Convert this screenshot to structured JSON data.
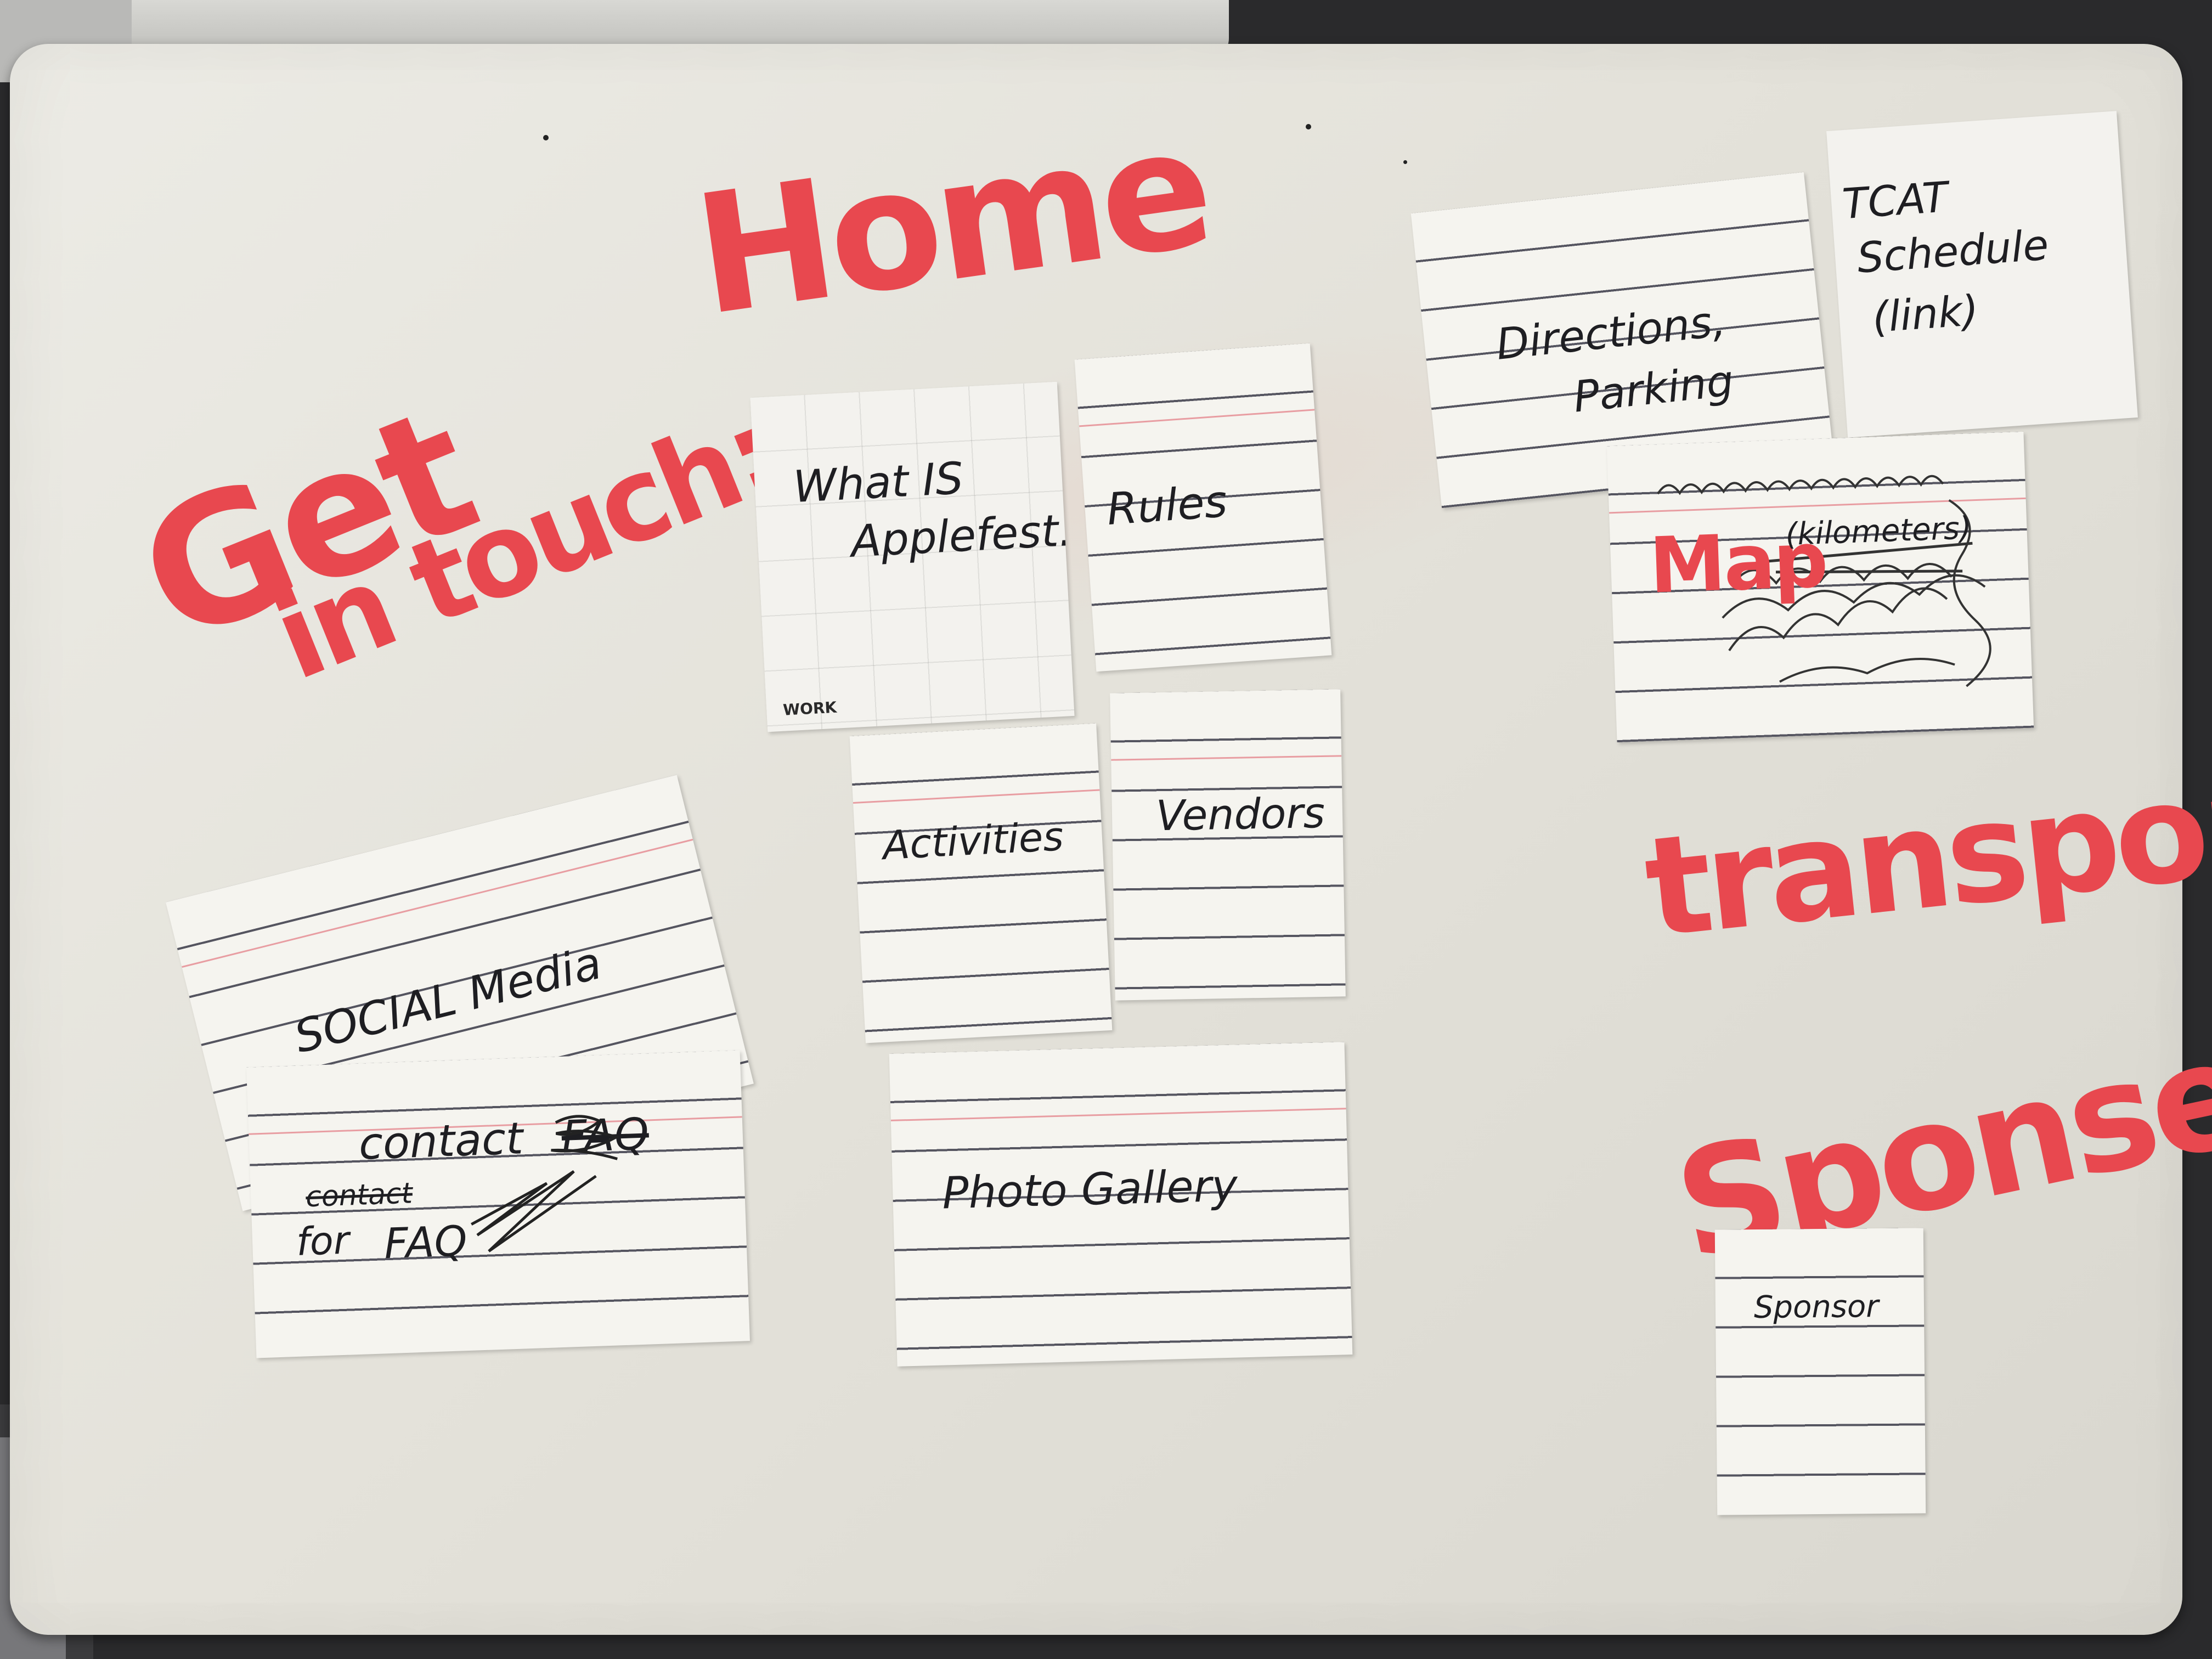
{
  "marker_headings": {
    "home": "Home",
    "get": "Get",
    "in_touch": "in touch:",
    "transport": "transport",
    "sponsers": "Sponsers"
  },
  "cards": {
    "what_is": {
      "line1": "What IS",
      "line2": "Applefest.",
      "brand": "WORK"
    },
    "rules": "Rules",
    "directions": {
      "line1": "Directions,",
      "line2": "Parking"
    },
    "tcat": {
      "line1": "TCAT",
      "line2": "Schedule",
      "line3": "(link)"
    },
    "map": {
      "label": "Map",
      "note": "(kilometers)"
    },
    "social_media": "SOCIAL Media",
    "activities": "Activities",
    "vendors": "Vendors",
    "contact": {
      "title": "contact",
      "crossed_top": "FAQ",
      "crossed_left": "contact",
      "line2": "for",
      "line3": "FAQ"
    },
    "photo_gallery": "Photo Gallery",
    "sponsor": "Sponsor"
  },
  "colors": {
    "marker_red": "#e8484f",
    "ink": "#1e1e22",
    "board": "#e8e6df",
    "card": "#f5f4ef"
  }
}
